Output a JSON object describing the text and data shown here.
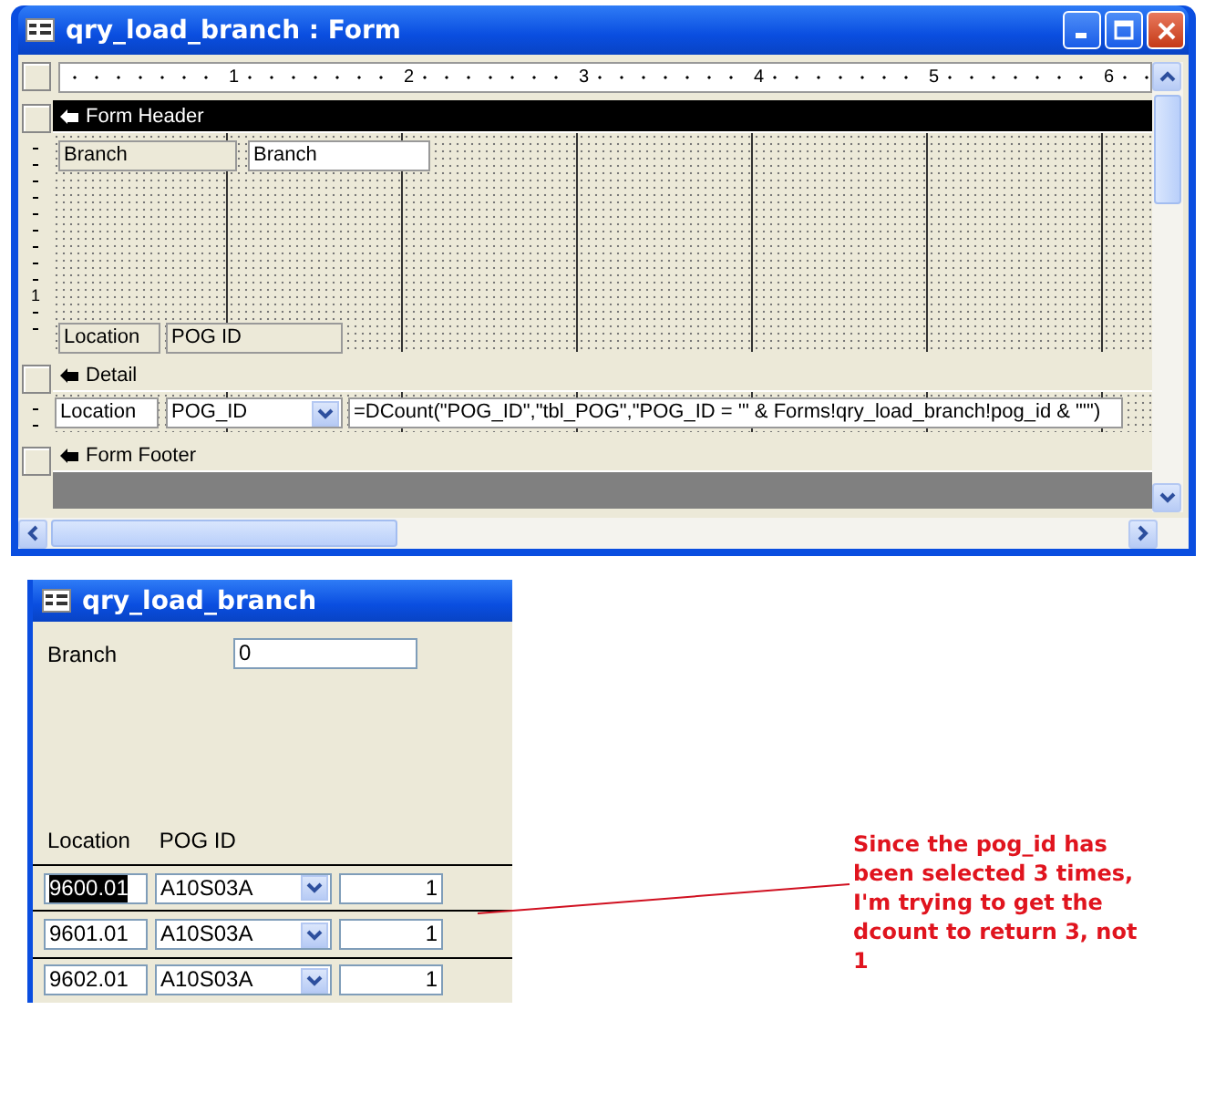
{
  "design_window": {
    "title": "qry_load_branch : Form",
    "ruler_numbers": [
      "1",
      "2",
      "3",
      "4",
      "5",
      "6"
    ],
    "vertical_ruler_number": "1",
    "sections": [
      {
        "kind": "header",
        "label": "Form Header",
        "selected": true,
        "controls": [
          {
            "kind": "label",
            "text": "Branch"
          },
          {
            "kind": "textbox",
            "text": "Branch"
          },
          {
            "kind": "label",
            "text": "Location"
          },
          {
            "kind": "label",
            "text": "POG ID"
          }
        ]
      },
      {
        "kind": "detail",
        "label": "Detail",
        "selected": false,
        "controls": [
          {
            "kind": "textbox",
            "text": "Location"
          },
          {
            "kind": "combo",
            "text": "POG_ID"
          },
          {
            "kind": "textbox",
            "text": "=DCount(\"POG_ID\",\"tbl_POG\",\"POG_ID = '\" & Forms!qry_load_branch!pog_id & \"'\")"
          }
        ]
      },
      {
        "kind": "footer",
        "label": "Form Footer",
        "selected": false
      }
    ]
  },
  "form_window": {
    "title": "qry_load_branch",
    "branch_label": "Branch",
    "branch_value": "0",
    "columns": [
      "Location",
      "POG ID"
    ],
    "rows": [
      {
        "location": "9600.01",
        "pog_id": "A10S03A",
        "count": "1",
        "selected": true
      },
      {
        "location": "9601.01",
        "pog_id": "A10S03A",
        "count": "1",
        "selected": false
      },
      {
        "location": "9602.01",
        "pog_id": "A10S03A",
        "count": "1",
        "selected": false
      }
    ]
  },
  "annotation": {
    "text": "Since the pog_id has been selected 3 times, I'm trying to get the dcount to return 3, not 1"
  }
}
